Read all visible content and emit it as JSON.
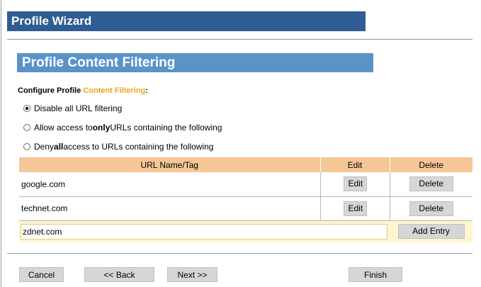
{
  "wizard": {
    "title": "Profile Wizard"
  },
  "section": {
    "title": "Profile Content Filtering"
  },
  "configure": {
    "prefix": "Configure Profile ",
    "accent": "Content Filtering",
    "suffix": ":",
    "accent_color": "#f0a31a"
  },
  "options": [
    {
      "label": "Disable all URL filtering",
      "selected": true
    },
    {
      "label_before": "Allow access to ",
      "label_bold": "only",
      "label_after": " URLs containing the following",
      "selected": false
    },
    {
      "label_before": "Deny ",
      "label_bold": "all",
      "label_after": " access to URLs containing the following",
      "selected": false
    }
  ],
  "table": {
    "headers": {
      "url": "URL Name/Tag",
      "edit": "Edit",
      "delete": "Delete"
    },
    "rows": [
      {
        "url": "google.com",
        "edit_label": "Edit",
        "delete_label": "Delete"
      },
      {
        "url": "technet.com",
        "edit_label": "Edit",
        "delete_label": "Delete"
      }
    ],
    "new_entry": {
      "value": "zdnet.com",
      "add_label": "Add Entry"
    }
  },
  "footer": {
    "cancel": "Cancel",
    "back": "<< Back",
    "next": "Next >>",
    "finish": "Finish"
  },
  "colors": {
    "wizard_banner": "#2f5d93",
    "section_banner": "#5a93c8",
    "header_row": "#f6c796",
    "entry_row": "#fff6cf",
    "button": "#d6d6d6"
  }
}
